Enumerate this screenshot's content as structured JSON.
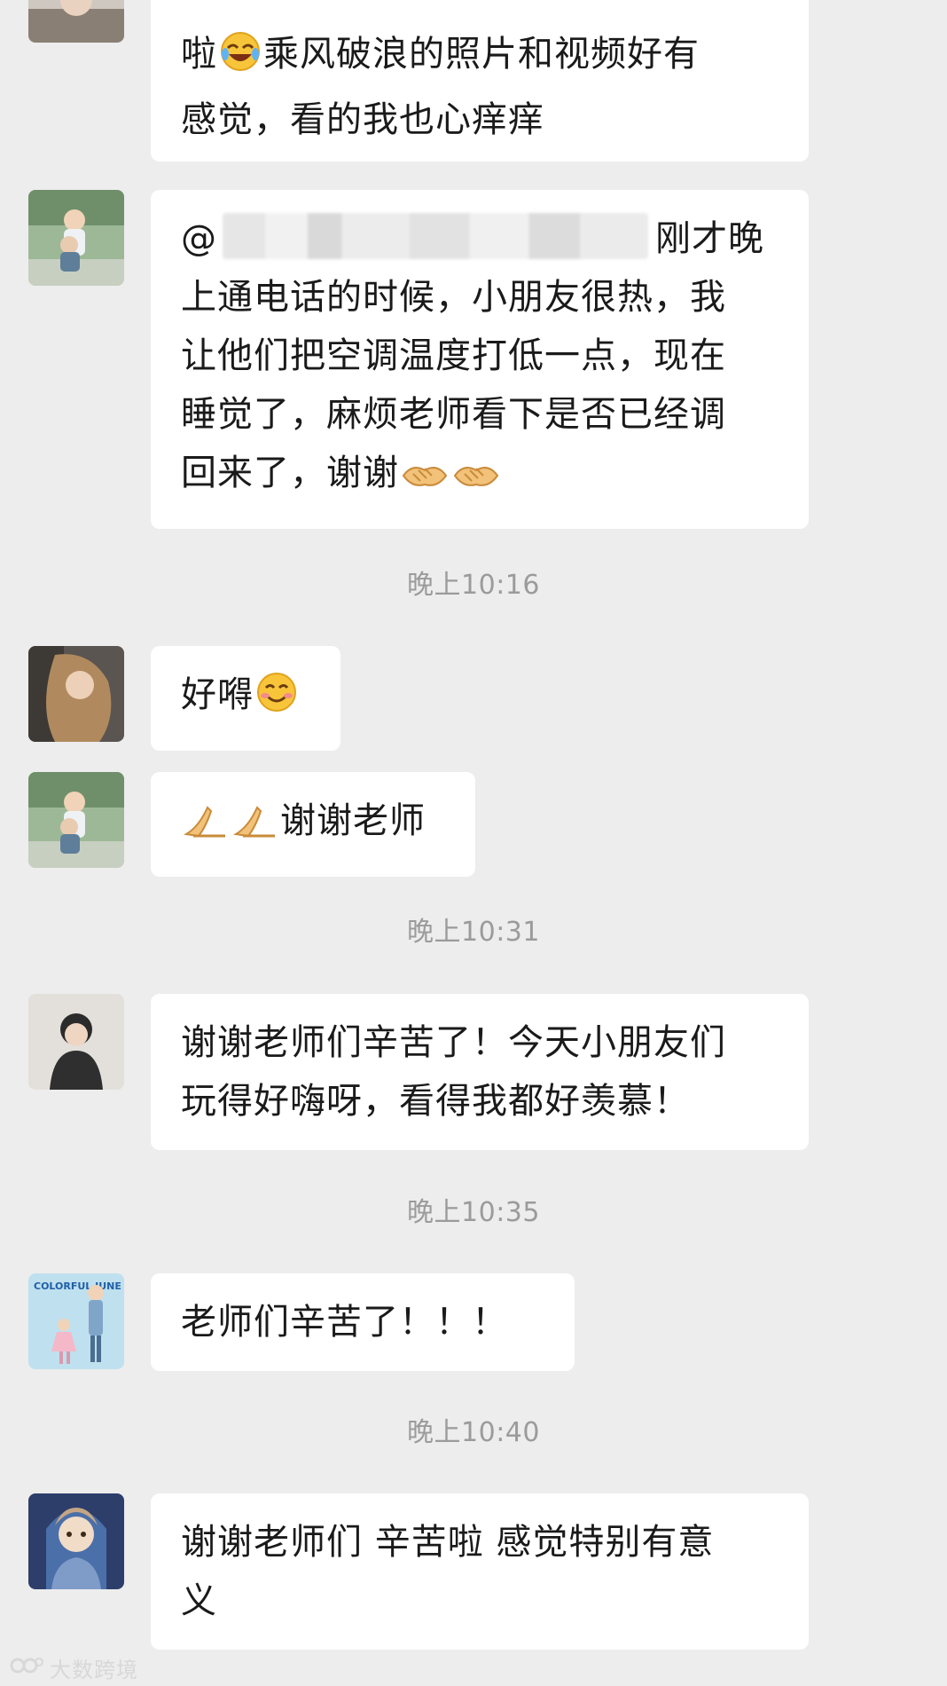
{
  "messages": [
    {
      "lines": [
        "啦",
        "乘风破浪的照片和视频好有",
        "感觉，看的我也心痒痒"
      ]
    },
    {
      "lines": [
        "@",
        "刚才晚",
        "上通电话的时候，小朋友很热，我",
        "让他们把空调温度打低一点，现在",
        "睡觉了，麻烦老师看下是否已经调",
        "回来了，谢谢"
      ]
    },
    {
      "text": "好嘚"
    },
    {
      "text": "谢谢老师"
    },
    {
      "lines": [
        "谢谢老师们辛苦了！今天小朋友们",
        "玩得好嗨呀，看得我都好羡慕！"
      ]
    },
    {
      "text": "老师们辛苦了！！！"
    },
    {
      "lines": [
        "谢谢老师们 辛苦啦 感觉特别有意",
        "义"
      ]
    }
  ],
  "timestamps": [
    "晚上10:16",
    "晚上10:31",
    "晚上10:35",
    "晚上10:40"
  ],
  "watermark": "大数跨境",
  "avatar_art": {
    "colorful_june": "COLORFUL JUNE"
  },
  "colors": {
    "background": "#ededed",
    "bubble": "#ffffff",
    "timestamp": "#9b9b9b",
    "text": "#1a1a1a"
  }
}
